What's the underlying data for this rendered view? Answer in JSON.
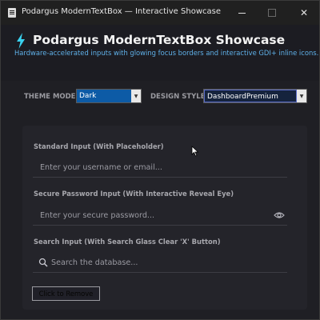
{
  "window": {
    "title": "Podargus ModernTextBox — Interactive Showcase",
    "icon": "app-icon"
  },
  "header": {
    "title": "Podargus ModernTextBox Showcase",
    "subtitle": "Hardware-accelerated inputs with glowing focus borders and interactive GDI+ inline icons.",
    "icon": "lightning-bolt-icon",
    "accent_color": "#39d1ef"
  },
  "theme": {
    "mode_label": "THEME MODE:",
    "mode_value": "Dark",
    "style_label": "DESIGN STYLE:",
    "style_value": "DashboardPremium"
  },
  "fields": {
    "standard": {
      "label": "Standard Input (With Placeholder)",
      "placeholder": "Enter your username or email...",
      "value": ""
    },
    "password": {
      "label": "Secure Password Input (With Interactive Reveal Eye)",
      "placeholder": "Enter your secure password...",
      "value": "",
      "icon": "eye-icon"
    },
    "search": {
      "label": "Search Input (With Search Glass  Clear 'X' Button)",
      "placeholder": "Search the database...",
      "value": "",
      "icon": "search-icon"
    }
  },
  "actions": {
    "remove_label": "Click to Remove"
  }
}
